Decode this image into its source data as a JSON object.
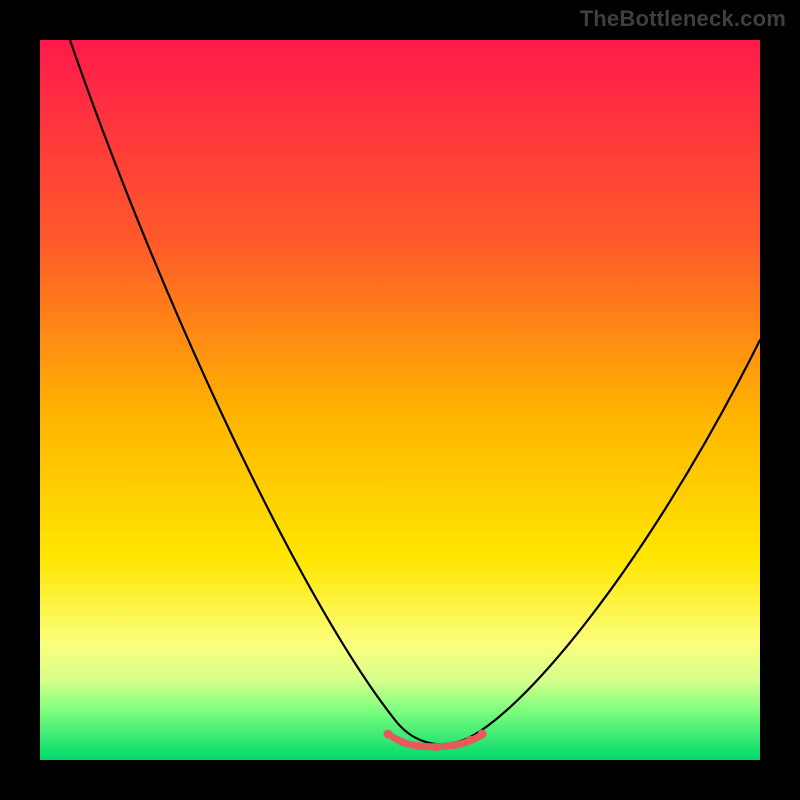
{
  "domain": "Chart",
  "watermark": "TheBottleneck.com",
  "colors": {
    "frame": "#000000",
    "gradient_top": "#ff1a4b",
    "gradient_bottom": "#00d86b",
    "curve": "#000000",
    "highlight": "#e85a5a",
    "watermark": "#3f3f3f"
  },
  "chart_data": {
    "type": "line",
    "title": "",
    "xlabel": "",
    "ylabel": "",
    "xlim": [
      0,
      100
    ],
    "ylim": [
      0,
      100
    ],
    "grid": false,
    "legend": false,
    "series": [
      {
        "name": "curve",
        "x": [
          5,
          10,
          15,
          20,
          25,
          30,
          35,
          40,
          45,
          50,
          52,
          54,
          56,
          58,
          60,
          65,
          70,
          75,
          80,
          85,
          90,
          95,
          100
        ],
        "values": [
          100,
          90,
          80,
          70,
          60,
          50,
          40,
          30,
          20,
          10,
          5,
          3,
          2,
          2,
          3,
          6,
          12,
          19,
          27,
          35,
          43,
          51,
          58
        ]
      }
    ],
    "highlight_flat_region": {
      "x_start": 50,
      "x_end": 60,
      "y": 2
    },
    "annotations": []
  }
}
